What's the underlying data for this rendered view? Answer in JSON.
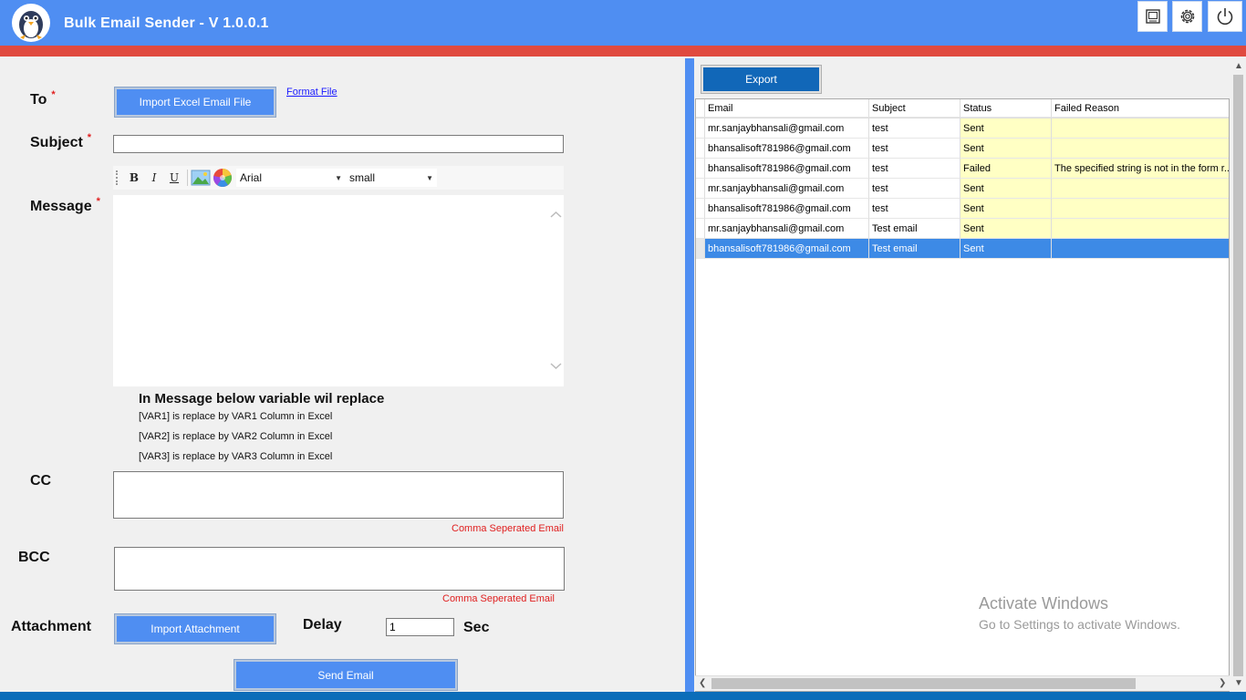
{
  "app": {
    "title": "Bulk Email Sender - V 1.0.0.1",
    "accent": "#4f8ef2",
    "stripe": "#e04a3f"
  },
  "titlebar_buttons": [
    {
      "icon": "tablet-icon"
    },
    {
      "icon": "gear-icon"
    },
    {
      "icon": "power-icon"
    }
  ],
  "form": {
    "to_label": "To",
    "required_mark": "*",
    "import_excel_label": "Import Excel Email File",
    "format_file_link": "Format File",
    "subject_label": "Subject",
    "subject_value": "",
    "message_label": "Message",
    "editor": {
      "bold": "B",
      "italic": "I",
      "underline": "U",
      "font": "Arial",
      "size": "small"
    },
    "message_value": "",
    "variables_title": "In Message below variable wil replace",
    "variables": [
      "[VAR1] is replace by VAR1 Column in Excel",
      "[VAR2] is replace by VAR2 Column in Excel",
      "[VAR3] is replace by VAR3 Column in Excel"
    ],
    "cc_label": "CC",
    "cc_value": "",
    "cc_hint": "Comma Seperated Email",
    "bcc_label": "BCC",
    "bcc_value": "",
    "bcc_hint": "Comma Seperated Email",
    "attachment_label": "Attachment",
    "import_attachment_label": "Import Attachment",
    "delay_label": "Delay",
    "delay_value": "1",
    "sec_label": "Sec",
    "send_label": "Send Email"
  },
  "results": {
    "export_label": "Export",
    "columns": [
      "Email",
      "Subject",
      "Status",
      "Failed Reason"
    ],
    "rows": [
      {
        "email": "mr.sanjaybhansali@gmail.com",
        "subject": "test",
        "status": "Sent",
        "reason": ""
      },
      {
        "email": "bhansalisoft781986@gmail.com",
        "subject": "test",
        "status": "Sent",
        "reason": ""
      },
      {
        "email": "bhansalisoft781986@gmail.com",
        "subject": "test",
        "status": "Failed",
        "reason": "The specified string is not in the form r..."
      },
      {
        "email": "mr.sanjaybhansali@gmail.com",
        "subject": "test",
        "status": "Sent",
        "reason": ""
      },
      {
        "email": "bhansalisoft781986@gmail.com",
        "subject": "test",
        "status": "Sent",
        "reason": ""
      },
      {
        "email": "mr.sanjaybhansali@gmail.com",
        "subject": "Test email",
        "status": "Sent",
        "reason": ""
      },
      {
        "email": "bhansalisoft781986@gmail.com",
        "subject": "Test email",
        "status": "Sent",
        "reason": ""
      }
    ],
    "selected_row_index": 6
  },
  "watermark": {
    "line1": "Activate Windows",
    "line2": "Go to Settings to activate Windows."
  }
}
